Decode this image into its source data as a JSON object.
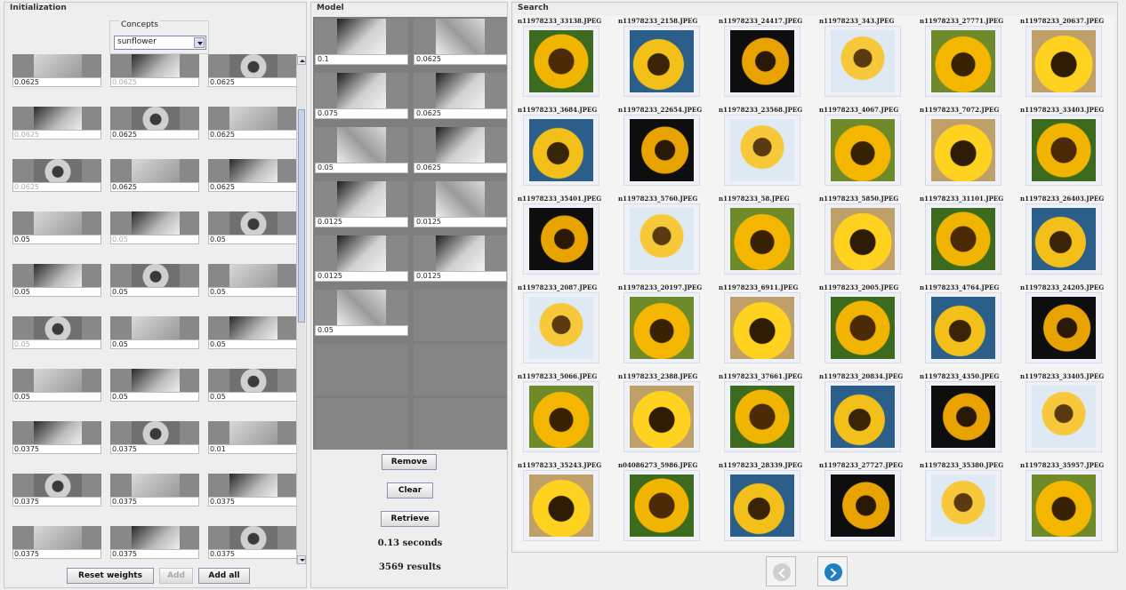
{
  "init": {
    "title": "Initialization",
    "concepts_label": "Concepts",
    "concept_selected": "sunflower",
    "weights": [
      [
        "0.0625",
        "0.0625",
        "0.0625"
      ],
      [
        "0.0625",
        "0.0625",
        "0.0625"
      ],
      [
        "0.0625",
        "0.0625",
        "0.0625"
      ],
      [
        "0.05",
        "0.05",
        "0.05"
      ],
      [
        "0.05",
        "0.05",
        "0.05"
      ],
      [
        "0.05",
        "0.05",
        "0.05"
      ],
      [
        "0.05",
        "0.05",
        "0.05"
      ],
      [
        "0.0375",
        "0.0375",
        "0.01"
      ],
      [
        "0.0375",
        "0.0375",
        "0.0375"
      ],
      [
        "0.0375",
        "0.0375",
        "0.0375"
      ]
    ],
    "faded": [
      [
        false,
        true,
        false
      ],
      [
        true,
        false,
        false
      ],
      [
        true,
        false,
        false
      ],
      [
        false,
        true,
        false
      ],
      [
        false,
        false,
        false
      ],
      [
        true,
        false,
        false
      ],
      [
        false,
        false,
        false
      ],
      [
        false,
        false,
        false
      ],
      [
        false,
        false,
        false
      ],
      [
        false,
        false,
        false
      ]
    ],
    "buttons": {
      "reset": "Reset weights",
      "add": "Add",
      "add_all": "Add all"
    }
  },
  "model": {
    "title": "Model",
    "weights": [
      "0.1",
      "0.0625",
      "0.075",
      "0.0625",
      "0.05",
      "0.0625",
      "0.0125",
      "0.0125",
      "0.0125",
      "0.0125",
      "0.05"
    ],
    "buttons": {
      "remove": "Remove",
      "clear": "Clear",
      "retrieve": "Retrieve"
    },
    "time": "0.13 seconds",
    "results": "3569 results"
  },
  "search": {
    "title": "Search",
    "filenames": [
      "n11978233_33138.JPEG",
      "n11978233_2158.JPEG",
      "n11978233_24417.JPEG",
      "n11978233_343.JPEG",
      "n11978233_27771.JPEG",
      "n11978233_20637.JPEG",
      "n11978233_3684.JPEG",
      "n11978233_22654.JPEG",
      "n11978233_23568.JPEG",
      "n11978233_4067.JPEG",
      "n11978233_7072.JPEG",
      "n11978233_33403.JPEG",
      "n11978233_35401.JPEG",
      "n11978233_5760.JPEG",
      "n11978233_58.JPEG",
      "n11978233_5850.JPEG",
      "n11978233_31101.JPEG",
      "n11978233_26403.JPEG",
      "n11978233_2087.JPEG",
      "n11978233_20197.JPEG",
      "n11978233_6911.JPEG",
      "n11978233_2005.JPEG",
      "n11978233_4764.JPEG",
      "n11978233_24205.JPEG",
      "n11978233_5066.JPEG",
      "n11978233_2388.JPEG",
      "n11978233_37661.JPEG",
      "n11978233_20834.JPEG",
      "n11978233_4350.JPEG",
      "n11978233_33405.JPEG",
      "n11978233_35243.JPEG",
      "n04086273_5986.JPEG",
      "n11978233_28339.JPEG",
      "n11978233_27727.JPEG",
      "n11978233_35380.JPEG",
      "n11978233_35957.JPEG"
    ]
  }
}
